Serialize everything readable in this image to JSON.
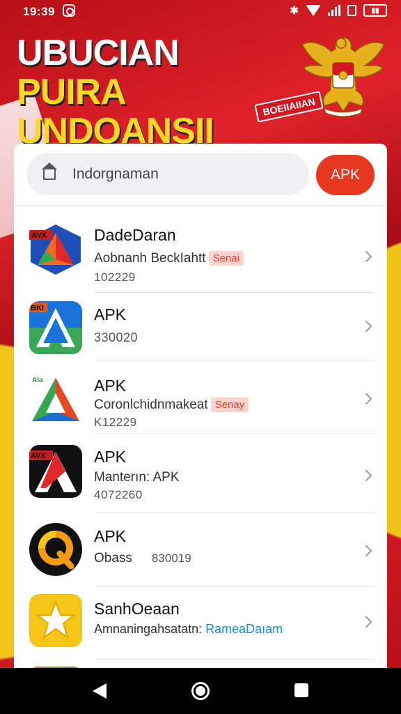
{
  "status_bar": {
    "time": "19:39"
  },
  "banner": {
    "line1_white": "UBUCIAN",
    "line1_yellow": "PUIRA",
    "line2": "UNDOANSII",
    "stamp": "BOEIIAIIAN"
  },
  "search": {
    "placeholder": "Indorgnaman",
    "button": "APK"
  },
  "apps": [
    {
      "title": "DadeDaran",
      "subtitle": "Aobnanh BeckIahtt",
      "tag": "Senai",
      "number": "102229",
      "icon": "triangle-logo-blue-icon",
      "badge": "AVX"
    },
    {
      "title": "APK",
      "subtitle": "",
      "tag": "",
      "number": "330020",
      "icon": "a-logo-blue-icon",
      "badge": "BKI"
    },
    {
      "title": "APK",
      "subtitle": "Coronlchidnmakeat",
      "tag": "Senay",
      "number": "K12229",
      "icon": "triangle-logo-green-icon",
      "badge": "Ala"
    },
    {
      "title": "APK",
      "subtitle": "Manterın: APK",
      "tag": "",
      "number": "4072260",
      "icon": "a-logo-black-icon",
      "badge": "AVX"
    },
    {
      "title": "APK",
      "subtitle": "Obass",
      "tag": "",
      "number": "830019",
      "icon": "q-logo-icon",
      "badge": ""
    },
    {
      "title": "SanhOeaan",
      "subtitle": "Amnaningahsatatn:",
      "link": "RameaDaıam",
      "tag": "",
      "number": "",
      "icon": "star-logo-icon",
      "badge": ""
    }
  ],
  "colors": {
    "accent": "#e8381f",
    "tag_bg": "#fbd4cf",
    "tag_text": "#e2412c",
    "link": "#1a8cc7",
    "banner_red": "#c8131b",
    "banner_yellow": "#ffd726"
  }
}
